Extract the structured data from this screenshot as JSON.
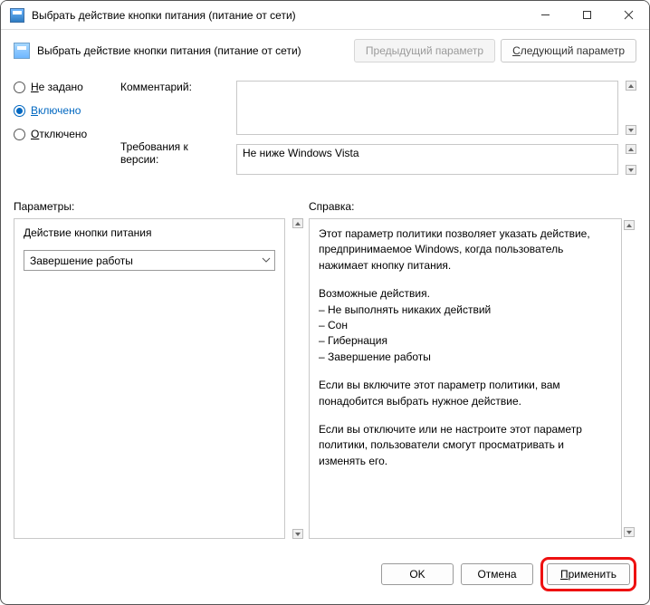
{
  "titlebar": {
    "title": "Выбрать действие кнопки питания (питание от сети)"
  },
  "header": {
    "caption": "Выбрать действие кнопки питания (питание от сети)",
    "prev": "Предыдущий параметр",
    "next": "Следующий параметр",
    "next_ul": "С"
  },
  "state": {
    "not_configured": "е задано",
    "not_configured_ul": "Н",
    "enabled": "ключено",
    "enabled_ul": "В",
    "disabled": "тключено",
    "disabled_ul": "О",
    "selected": "enabled"
  },
  "fields": {
    "comment_label": "Комментарий:",
    "version_label": "Требования к версии:",
    "version_value": "Не ниже Windows Vista"
  },
  "sections": {
    "options_label": "Параметры:",
    "help_label": "Справка:"
  },
  "options": {
    "action_label": "Действие кнопки питания",
    "action_value": "Завершение работы"
  },
  "help": {
    "p1": "Этот параметр политики позволяет указать действие, предпринимаемое Windows, когда пользователь нажимает кнопку питания.",
    "p2_head": "Возможные действия.",
    "p2_a": "– Не выполнять никаких действий",
    "p2_b": "– Сон",
    "p2_c": "– Гибернация",
    "p2_d": "– Завершение работы",
    "p3": "Если вы включите этот параметр политики, вам понадобится выбрать нужное действие.",
    "p4": "Если вы отключите или не настроите этот параметр политики, пользователи смогут просматривать и изменять его."
  },
  "footer": {
    "ok": "OK",
    "cancel": "Отмена",
    "apply": "Применить",
    "apply_ul": "П"
  }
}
